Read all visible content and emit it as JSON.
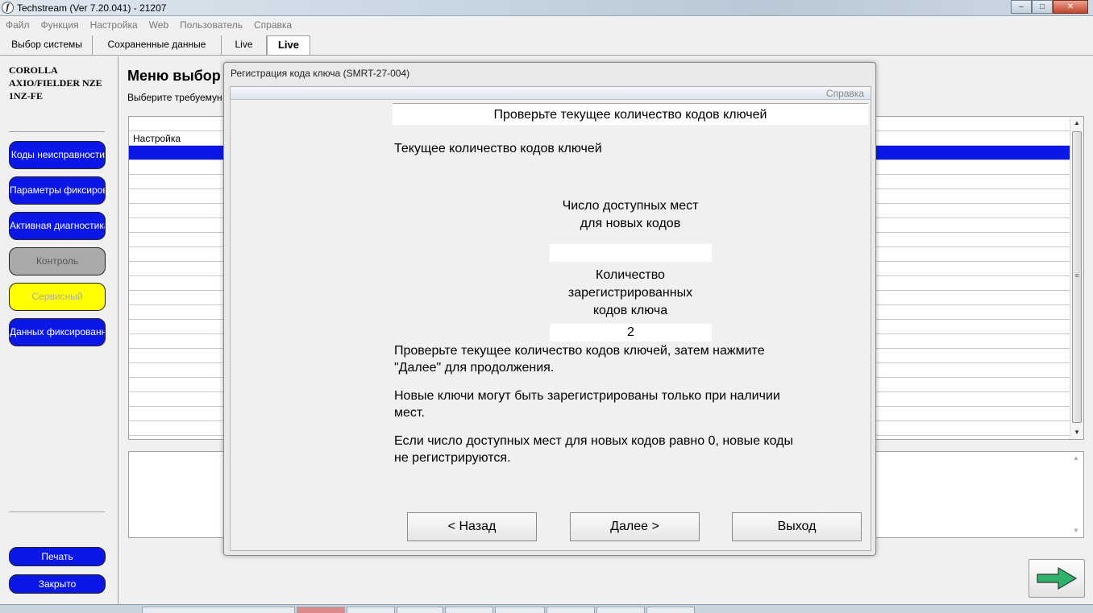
{
  "window": {
    "title": "Techstream (Ver 7.20.041) - 21207",
    "app_icon": "f",
    "minimize": "–",
    "maximize": "□",
    "close": "✕"
  },
  "menu": [
    "Файл",
    "Функция",
    "Настройка",
    "Web",
    "Пользователь",
    "Справка"
  ],
  "tabs": [
    "Выбор системы",
    "Сохраненные данные",
    "Live",
    "Live"
  ],
  "sidebar": {
    "vehicle_lines": [
      "COROLLA",
      "AXIO/FIELDER NZE",
      "1NZ-FE"
    ],
    "items": [
      "Коды неисправности",
      "Параметры фиксированного",
      "Активная диагностика",
      "Контроль",
      "Сервисный",
      "Данных фиксированного"
    ],
    "print": "Печать",
    "close": "Закрыто"
  },
  "main": {
    "title": "Меню выбор",
    "subtitle": "Выберите требуемун",
    "rows": [
      "",
      "Настройка"
    ]
  },
  "dialog": {
    "title": "Регистрация кода ключа (SMRT-27-004)",
    "help": "Справка",
    "step_header": "Проверьте текущее количество кодов ключей",
    "current_label": "Текущее количество кодов ключей",
    "free_slots_line1": "Число доступных мест",
    "free_slots_line2": "для новых кодов",
    "free_slots_value": "",
    "registered_line1": "Количество",
    "registered_line2": "зарегистрированных",
    "registered_line3": "кодов ключа",
    "registered_value": "2",
    "para1_line1": "Проверьте текущее количество кодов ключей, затем нажмите",
    "para1_line2": "\"Далее\" для продолжения.",
    "para2_line1": "Новые ключи могут быть зарегистрированы только при наличии",
    "para2_line2": "мест.",
    "para3_line1": "Если число доступных мест для новых кодов равно 0, новые коды",
    "para3_line2": "не регистрируются.",
    "back": "< Назад",
    "next": "Далее >",
    "exit": "Выход"
  },
  "icons": {
    "next_arrow": "green-arrow-right-icon",
    "scroll_up": "▲",
    "scroll_down": "▼",
    "scroll_grip": "≡"
  },
  "colors": {
    "nav_blue": "#0b17e6",
    "service_yellow": "#ffff00",
    "arrow_green": "#2fb36a"
  }
}
